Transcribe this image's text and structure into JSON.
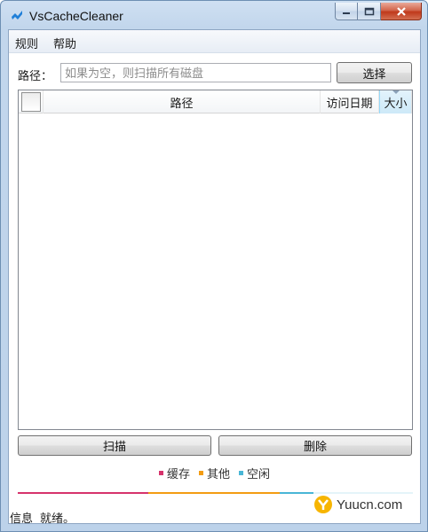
{
  "window": {
    "title": "VsCacheCleaner",
    "icon": "vs-logo-icon",
    "accent": "#1f7fd8"
  },
  "menu": {
    "items": [
      {
        "label": "规则"
      },
      {
        "label": "帮助"
      }
    ]
  },
  "path": {
    "label": "路径：",
    "placeholder": "如果为空，则扫描所有磁盘",
    "value": "",
    "select_button": "选择"
  },
  "table": {
    "columns": [
      "路径",
      "访问日期",
      "大小"
    ],
    "sorted_column": "大小",
    "rows": []
  },
  "actions": {
    "scan_button": "扫描",
    "delete_button": "删除"
  },
  "legend": [
    {
      "label": "缓存",
      "color": "#d6336c"
    },
    {
      "label": "其他",
      "color": "#f39c12"
    },
    {
      "label": "空闲",
      "color": "#49b6d6"
    }
  ],
  "status": {
    "label": "信息",
    "text": "就绪。"
  },
  "watermark": {
    "text": "Yuucn.com"
  }
}
